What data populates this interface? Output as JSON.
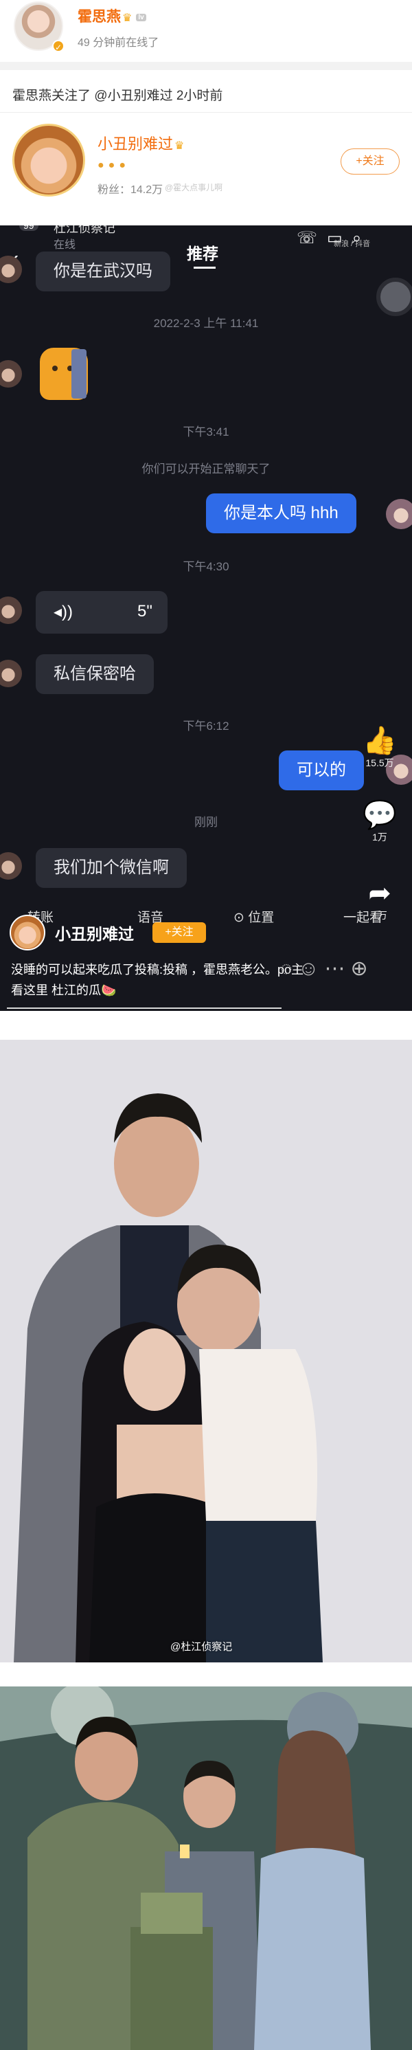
{
  "header": {
    "name": "霍思燕",
    "level_badge": "lv",
    "online_status": "49 分钟前在线了"
  },
  "activity": {
    "text": "霍思燕关注了 @小丑别难过 2小时前"
  },
  "user_card": {
    "name": "小丑别难过",
    "fans": "粉丝：14.2万",
    "follow_label": "+关注",
    "watermark": "@霍大点事儿啊"
  },
  "chat": {
    "badge_count": "99",
    "contact_name": "杜江侦察记",
    "contact_status": "在线",
    "tab": "推荐",
    "watermark_top": "新浪 / 抖音",
    "messages": {
      "m1": "你是在武汉吗",
      "ts1": "2022-2-3 上午 11:41",
      "ts2": "下午3:41",
      "system": "你们可以开始正常聊天了",
      "m2": "你是本人吗 hhh",
      "ts3": "下午4:30",
      "voice_length": "5\"",
      "m3": "私信保密哈",
      "ts4": "下午6:12",
      "m4": "可以的",
      "ts5": "刚刚",
      "m5": "我们加个微信啊"
    },
    "rail": {
      "likes": "15.5万",
      "comments": "1万",
      "shares": "1万"
    },
    "bottom_bar": [
      "转账",
      "语音",
      "位置",
      "一起看"
    ],
    "poster_name": "小丑别难过",
    "poster_follow": "+关注",
    "caption": "没睡的可以起来吃瓜了投稿:投稿 ，霍思燕老公。po主看这里 杜江的瓜🍉"
  },
  "photos": {
    "watermark": "@杜江侦察记"
  },
  "colors": {
    "accent_orange": "#f26c0d",
    "chat_bg": "#15161d",
    "bubble_blue": "#2f6be8",
    "follow_yellow": "#f7a21a"
  }
}
